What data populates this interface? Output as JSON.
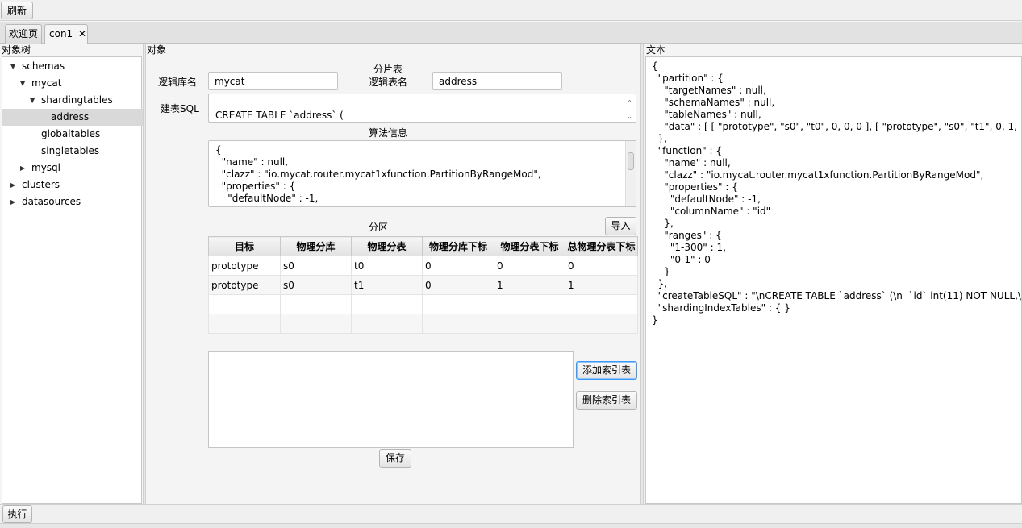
{
  "toolbar": {
    "refresh_label": "刷新"
  },
  "tabs": [
    {
      "label": "欢迎页"
    },
    {
      "label": "con1",
      "close": "✕"
    }
  ],
  "tree": {
    "header": "对象树",
    "items": [
      {
        "label": "schemas",
        "arrow": "▼"
      },
      {
        "label": "mycat",
        "arrow": "▼"
      },
      {
        "label": "shardingtables",
        "arrow": "▼"
      },
      {
        "label": "address",
        "arrow": ""
      },
      {
        "label": "globaltables",
        "arrow": ""
      },
      {
        "label": "singletables",
        "arrow": ""
      },
      {
        "label": "mysql",
        "arrow": "▶"
      },
      {
        "label": "clusters",
        "arrow": "▶"
      },
      {
        "label": "datasources",
        "arrow": "▶"
      }
    ]
  },
  "object_panel": {
    "header": "对象",
    "logical_db_label": "逻辑库名",
    "logical_db_value": "mycat",
    "shard_table_title": "分片表",
    "logical_table_label": "逻辑表名",
    "logical_table_value": "address",
    "create_sql_label": "建表SQL",
    "create_sql_value": "CREATE TABLE `address` (",
    "algorithm_title": "算法信息",
    "algorithm_text": "{\n  \"name\" : null,\n  \"clazz\" : \"io.mycat.router.mycat1xfunction.PartitionByRangeMod\",\n  \"properties\" : {\n    \"defaultNode\" : -1,",
    "partition_title": "分区",
    "import_label": "导入",
    "columns": [
      "目标",
      "物理分库",
      "物理分表",
      "物理分库下标",
      "物理分表下标",
      "总物理分表下标"
    ],
    "rows": [
      [
        "prototype",
        "s0",
        "t0",
        "0",
        "0",
        "0"
      ],
      [
        "prototype",
        "s0",
        "t1",
        "0",
        "1",
        "1"
      ]
    ],
    "add_index_label": "添加索引表",
    "delete_index_label": "删除索引表",
    "save_label": "保存"
  },
  "text_panel": {
    "header": "文本",
    "content": "{\n  \"partition\" : {\n    \"targetNames\" : null,\n    \"schemaNames\" : null,\n    \"tableNames\" : null,\n    \"data\" : [ [ \"prototype\", \"s0\", \"t0\", 0, 0, 0 ], [ \"prototype\", \"s0\", \"t1\", 0, 1, 1 ] ]\n  },\n  \"function\" : {\n    \"name\" : null,\n    \"clazz\" : \"io.mycat.router.mycat1xfunction.PartitionByRangeMod\",\n    \"properties\" : {\n      \"defaultNode\" : -1,\n      \"columnName\" : \"id\"\n    },\n    \"ranges\" : {\n      \"1-300\" : 1,\n      \"0-1\" : 0\n    }\n  },\n  \"createTableSQL\" : \"\\nCREATE TABLE `address` (\\n  `id` int(11) NOT NULL,\\n  `ad\n  \"shardingIndexTables\" : { }\n}"
  },
  "bottom": {
    "execute_label": "执行"
  }
}
